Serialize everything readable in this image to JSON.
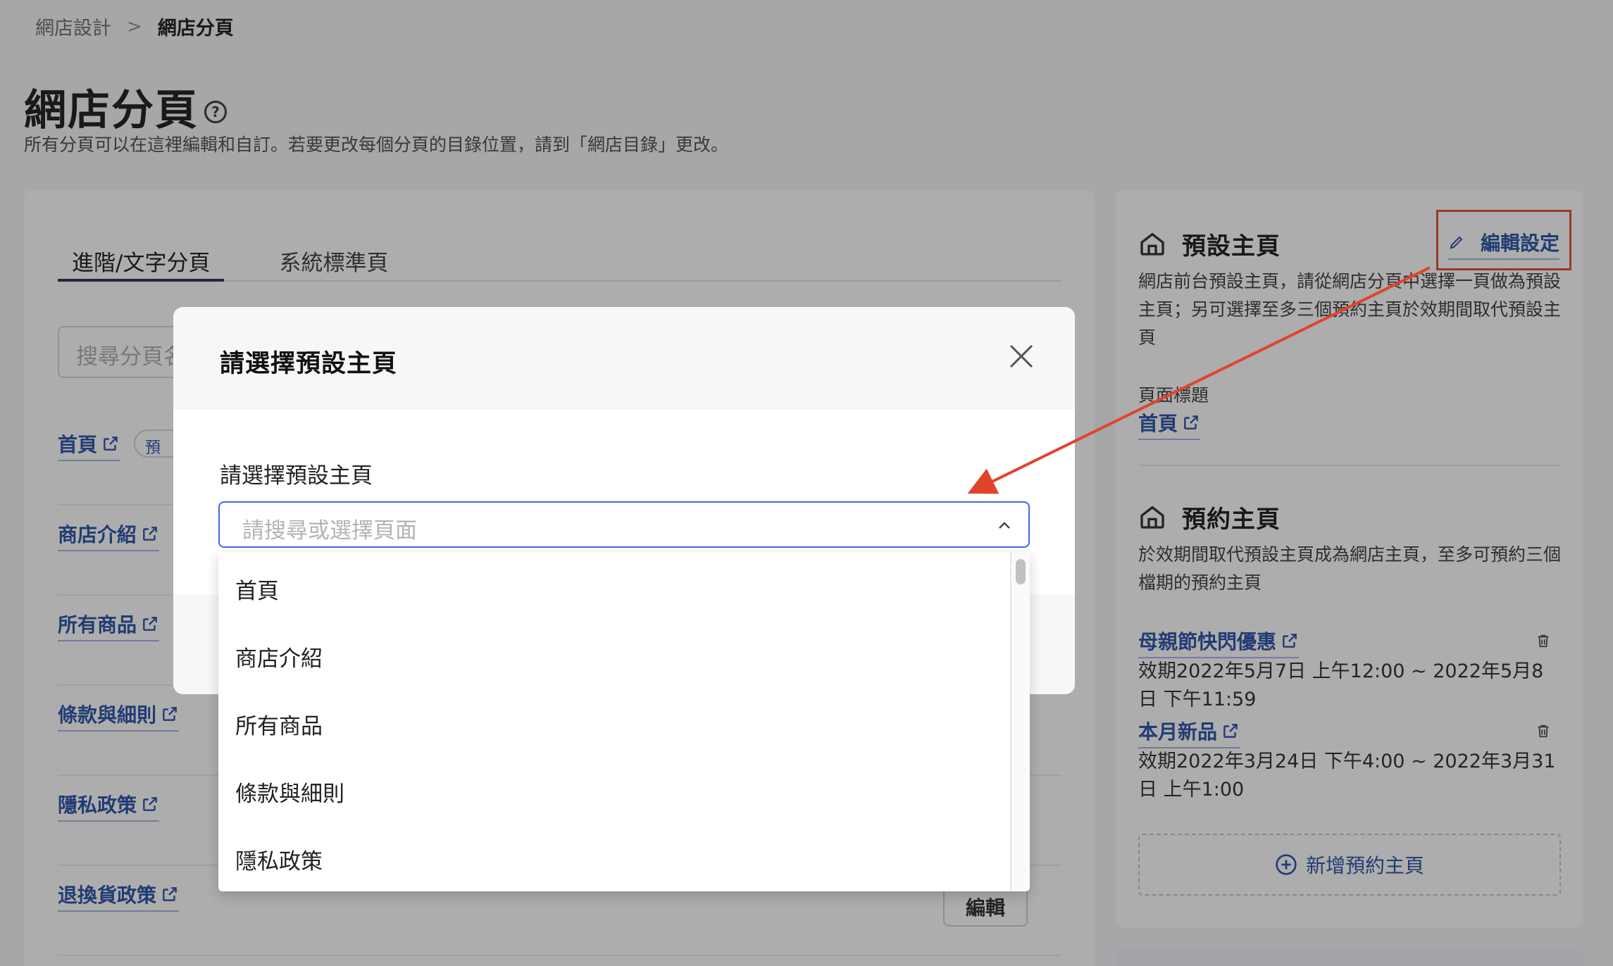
{
  "breadcrumb": {
    "parent": "網店設計",
    "separator": ">",
    "current": "網店分頁"
  },
  "page": {
    "title": "網店分頁",
    "help_icon": "?",
    "description": "所有分頁可以在這裡編輯和自訂。若要更改每個分頁的目錄位置，請到「網店目錄」更改。"
  },
  "tabs": [
    {
      "label": "進階/文字分頁",
      "active": true
    },
    {
      "label": "系統標準頁",
      "active": false
    }
  ],
  "search": {
    "placeholder": "搜尋分頁名"
  },
  "pages": [
    {
      "title": "首頁",
      "badge": "預"
    },
    {
      "title": "商店介紹"
    },
    {
      "title": "所有商品"
    },
    {
      "title": "條款與細則"
    },
    {
      "title": "隱私政策"
    },
    {
      "title": "退換貨政策"
    }
  ],
  "edit_label": "編輯",
  "default_home": {
    "title": "預設主頁",
    "edit_settings_label": "編輯設定",
    "description": "網店前台預設主頁，請從網店分頁中選擇一頁做為預設主頁；另可選擇至多三個預約主頁於效期間取代預設主頁",
    "page_title_label": "頁面標題",
    "page_title_value": "首頁"
  },
  "scheduled_home": {
    "title": "預約主頁",
    "description": "於效期間取代預設主頁成為網店主頁，至多可預約三個檔期的預約主頁",
    "items": [
      {
        "name": "母親節快閃優惠",
        "period": "效期2022年5月7日 上午12:00 ~ 2022年5月8日 下午11:59"
      },
      {
        "name": "本月新品",
        "period": "效期2022年3月24日 下午4:00 ~ 2022年3月31日 上午1:00"
      }
    ],
    "add_label": "新增預約主頁"
  },
  "modal": {
    "title": "請選擇預設主頁",
    "field_label": "請選擇預設主頁",
    "select_placeholder": "請搜尋或選擇頁面",
    "options": [
      "首頁",
      "商店介紹",
      "所有商品",
      "條款與細則",
      "隱私政策"
    ]
  },
  "colors": {
    "link": "#1e4aa3",
    "annotation": "#e0452b",
    "focus": "#3f6ad8"
  },
  "icons": {
    "help": "help-circle-icon",
    "external": "external-link-icon",
    "home": "home-icon",
    "pencil": "pencil-icon",
    "trash": "trash-icon",
    "plus": "plus-circle-icon",
    "close": "close-icon",
    "chevron": "chevron-up-icon"
  }
}
